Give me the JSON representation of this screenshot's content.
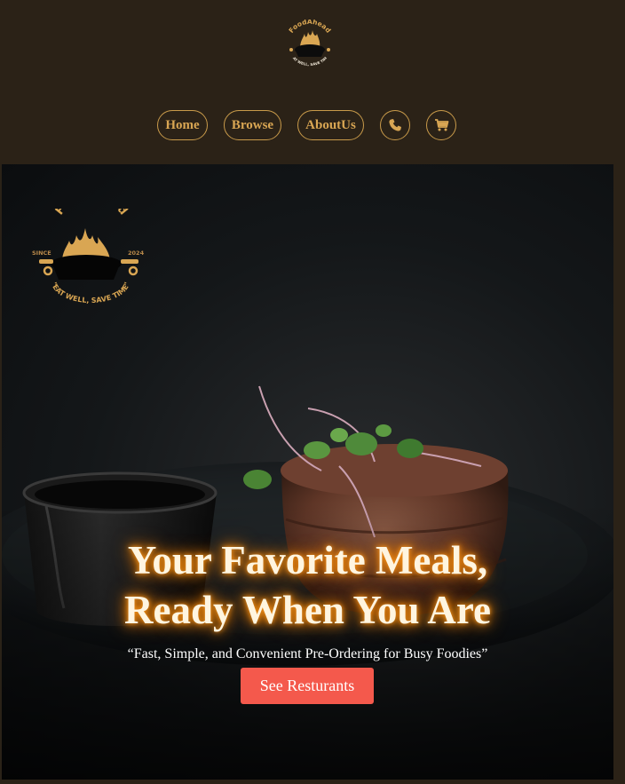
{
  "brand": {
    "name": "FoodAhead",
    "since": "SINCE",
    "year": "2024",
    "slogan": "\"EAT WELL, SAVE TIME\"",
    "accent": "#d9a653"
  },
  "nav": {
    "items": [
      {
        "label": "Home"
      },
      {
        "label": "Browse"
      },
      {
        "label": "AboutUs"
      }
    ],
    "phone_icon": "phone-icon",
    "cart_icon": "cart-icon"
  },
  "hero": {
    "title_line1": "Your Favorite Meals,",
    "title_line2": "Ready When You Are",
    "subtitle": "“Fast, Simple, and Convenient Pre-Ordering for Busy Foodies”",
    "cta_label": "See Resturants",
    "cta_color": "#f4594c"
  }
}
